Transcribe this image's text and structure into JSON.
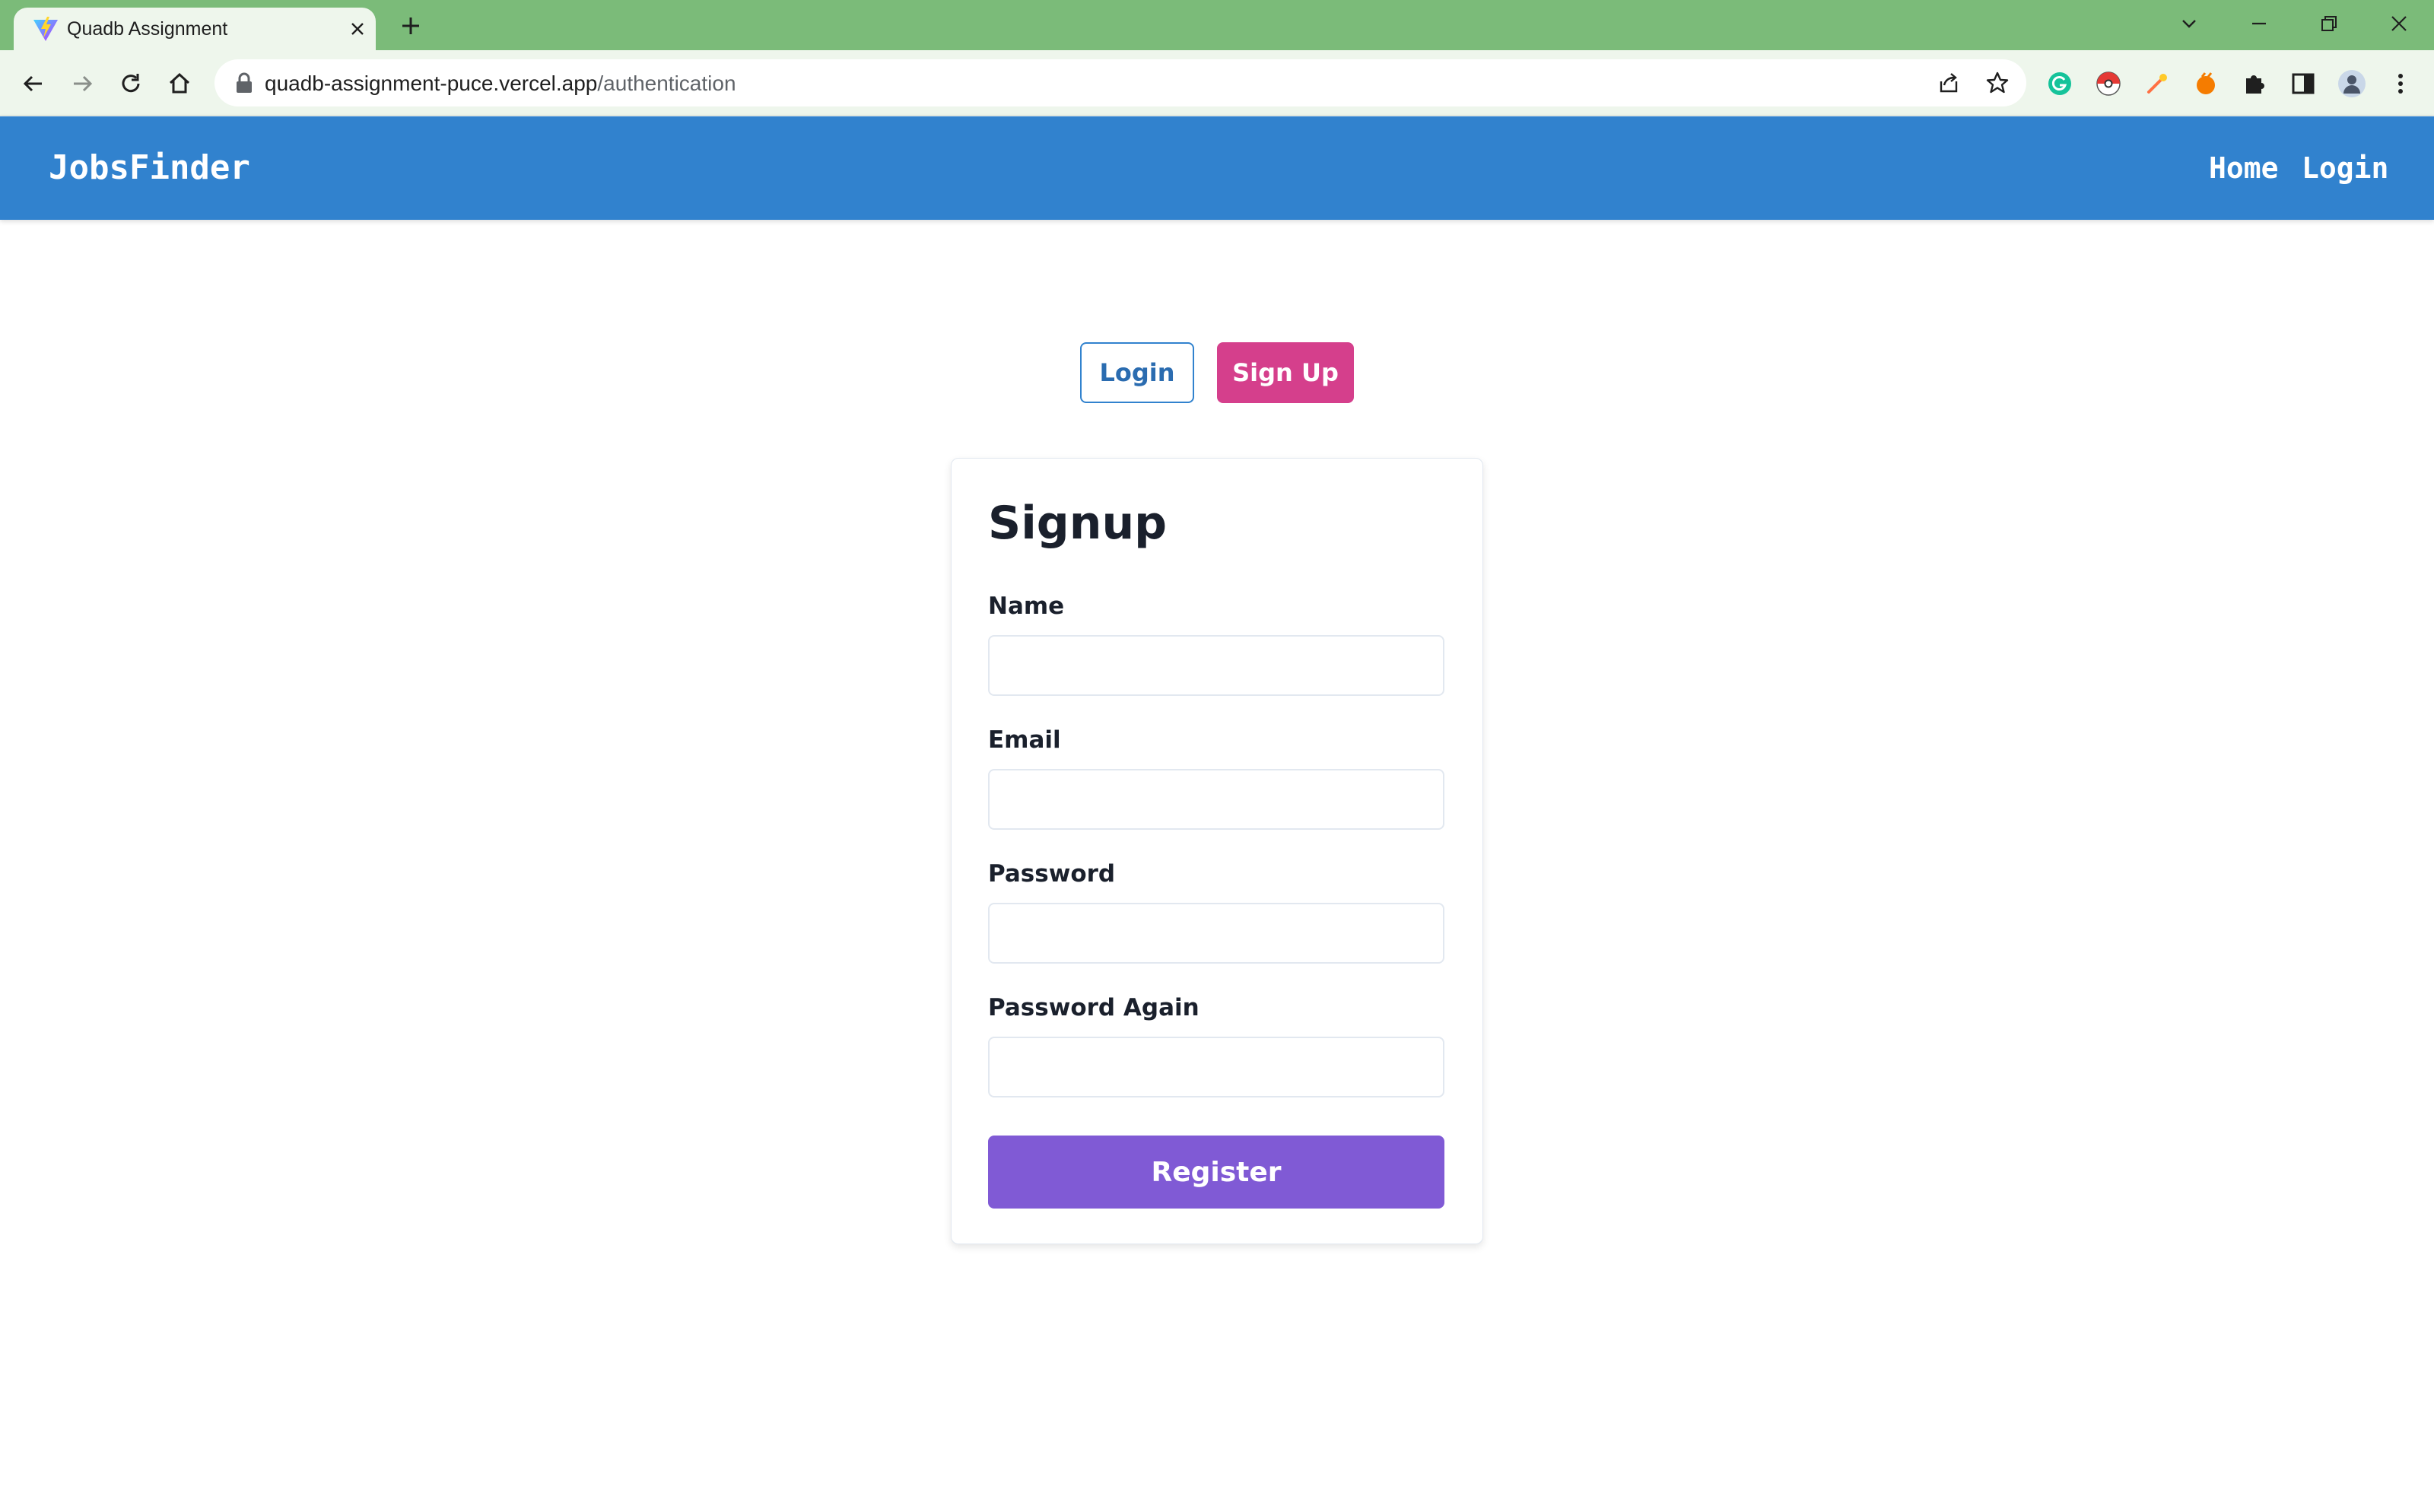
{
  "browser": {
    "tab_title": "Quadb Assignment",
    "url_host": "quadb-assignment-puce.vercel.app",
    "url_path": "/authentication",
    "tabbar_color": "#7bbb79",
    "toolbar_color": "#eef6ec"
  },
  "header": {
    "brand": "JobsFinder",
    "nav": [
      {
        "label": "Home"
      },
      {
        "label": "Login"
      }
    ],
    "color": "#3182ce"
  },
  "auth_toggle": {
    "login_label": "Login",
    "signup_label": "Sign Up",
    "active": "Sign Up",
    "signup_color": "#d53f8c"
  },
  "signup_form": {
    "title": "Signup",
    "fields": [
      {
        "label": "Name",
        "value": ""
      },
      {
        "label": "Email",
        "value": ""
      },
      {
        "label": "Password",
        "value": ""
      },
      {
        "label": "Password Again",
        "value": ""
      }
    ],
    "submit_label": "Register",
    "submit_color": "#805ad5"
  }
}
